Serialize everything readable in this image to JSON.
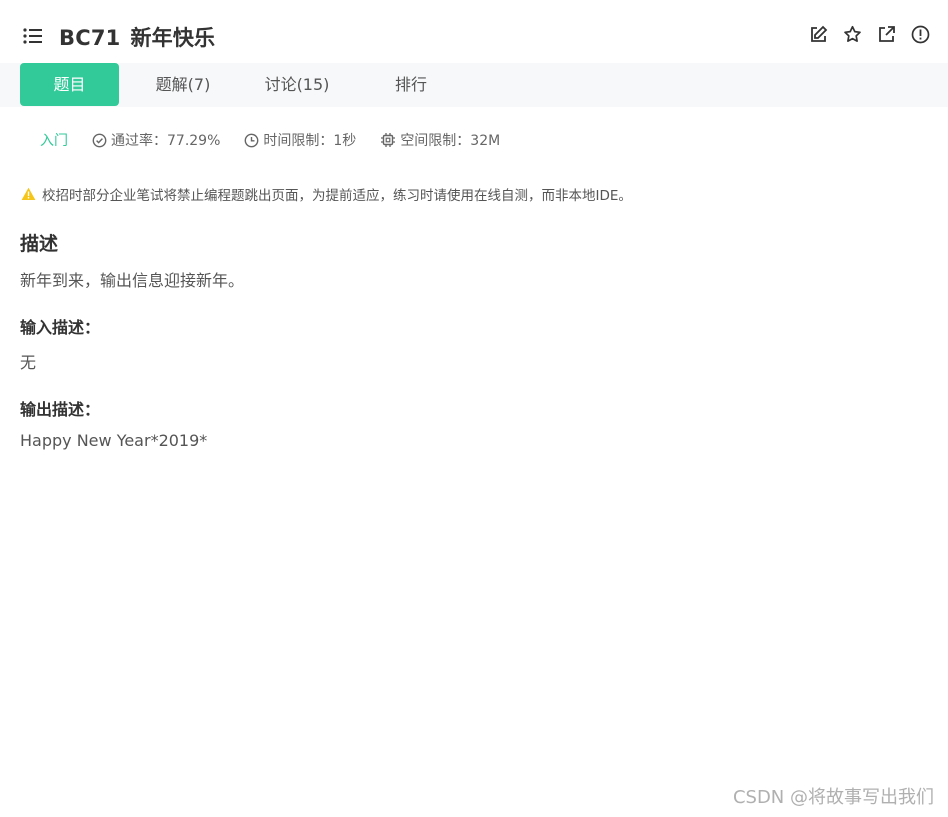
{
  "header": {
    "problem_id": "BC71",
    "problem_title": "新年快乐",
    "tools": [
      "edit-icon",
      "star-icon",
      "external-link-icon",
      "info-icon"
    ]
  },
  "tabs": [
    {
      "label": "题目",
      "active": true
    },
    {
      "label": "题解(7)",
      "active": false
    },
    {
      "label": "讨论(15)",
      "active": false
    },
    {
      "label": "排行",
      "active": false
    }
  ],
  "meta": {
    "level": "入门",
    "pass_rate": "通过率：77.29%",
    "time_limit": "时间限制：1秒",
    "memory_limit": "空间限制：32M"
  },
  "warning": "校招时部分企业笔试将禁止编程题跳出页面，为提前适应，练习时请使用在线自测，而非本地IDE。",
  "content": {
    "desc_title": "描述",
    "desc_text": "新年到来，输出信息迎接新年。",
    "input_title": "输入描述：",
    "input_text": "无",
    "output_title": "输出描述：",
    "output_text": "Happy New Year*2019*"
  },
  "watermark": "CSDN @将故事写出我们",
  "colors": {
    "accent": "#32ca99",
    "warning": "#f5c518"
  }
}
